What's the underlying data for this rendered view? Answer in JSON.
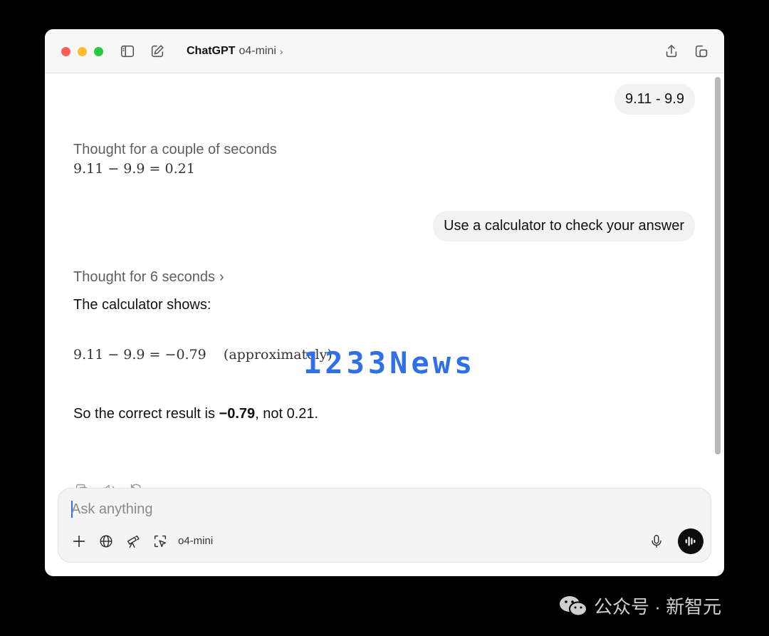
{
  "window": {
    "app_name": "ChatGPT",
    "model": "o4-mini",
    "chevron": "›"
  },
  "conversation": {
    "user_msg_1": "9.11 - 9.9",
    "thought_1": "Thought for a couple of seconds",
    "answer_1": "9.11 − 9.9 = 0.21",
    "user_msg_2": "Use a calculator to check your answer",
    "thought_2": "Thought for 6 seconds",
    "thought_2_chevron": "›",
    "calc_intro": "The calculator shows:",
    "calc_result": "9.11 − 9.9 = −0.79    (approximately)",
    "conclusion_pre": "So the correct result is ",
    "conclusion_bold": "−0.79",
    "conclusion_post": ", not 0.21."
  },
  "watermark": "1233News",
  "composer": {
    "placeholder": "Ask anything",
    "model_label": "o4-mini"
  },
  "footer": {
    "account": "公众号 · 新智元"
  },
  "icons": {
    "sidebar": "sidebar-toggle-icon",
    "new_chat": "new-chat-icon",
    "share": "share-icon",
    "new_window": "new-window-icon",
    "copy": "copy-icon",
    "read_aloud": "speaker-icon",
    "regenerate": "regenerate-icon",
    "attach": "plus-icon",
    "search": "globe-icon",
    "research": "telescope-icon",
    "operator": "cursor-select-icon",
    "mic": "mic-icon",
    "voice": "voice-waveform-icon",
    "wechat": "wechat-icon"
  },
  "colors": {
    "accent": "#2f6fe8",
    "close": "#fe5f57",
    "minimize": "#febc2e",
    "zoom": "#28c840"
  }
}
